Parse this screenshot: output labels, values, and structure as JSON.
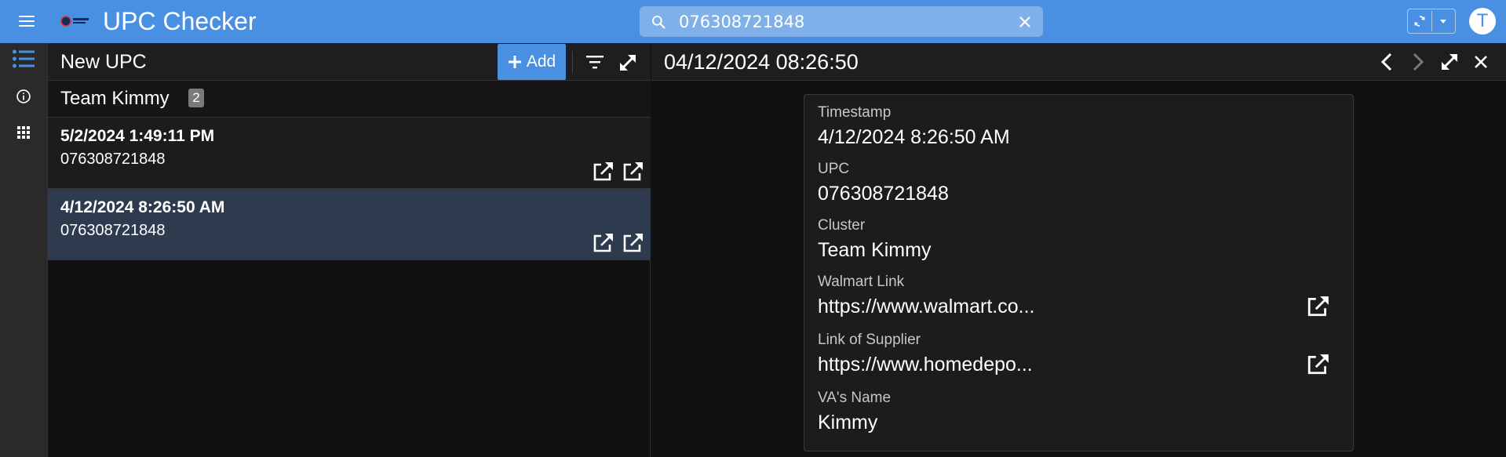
{
  "app": {
    "title": "UPC Checker",
    "user_initial": "T"
  },
  "colors": {
    "topbar": "#4a90e2",
    "selected_row": "#2e3b4e",
    "badge": "#7a7a7a"
  },
  "search": {
    "value": "076308721848"
  },
  "list": {
    "title": "New UPC",
    "add_label": "Add",
    "group": {
      "name": "Team Kimmy",
      "count": "2"
    },
    "rows": [
      {
        "timestamp": "5/2/2024 1:49:11 PM",
        "upc": "076308721848"
      },
      {
        "timestamp": "4/12/2024 8:26:50 AM",
        "upc": "076308721848"
      }
    ]
  },
  "detail": {
    "title": "04/12/2024 08:26:50",
    "fields": [
      {
        "label": "Timestamp",
        "value": "4/12/2024 8:26:50 AM"
      },
      {
        "label": "UPC",
        "value": "076308721848"
      },
      {
        "label": "Cluster",
        "value": "Team Kimmy"
      },
      {
        "label": "Walmart Link",
        "value": "https://www.walmart.co..."
      },
      {
        "label": "Link of Supplier",
        "value": "https://www.homedepo..."
      },
      {
        "label": "VA's Name",
        "value": "Kimmy"
      }
    ]
  },
  "icons": {
    "menu": "hamburger-menu-icon",
    "search": "search-icon",
    "clear": "close-icon",
    "sync": "sync-icon",
    "list": "list-icon",
    "info": "info-icon",
    "apps": "apps-grid-icon",
    "filter": "filter-icon",
    "expand": "expand-icon",
    "open": "open-in-new-icon",
    "prev": "chevron-left-icon",
    "next": "chevron-right-icon"
  }
}
